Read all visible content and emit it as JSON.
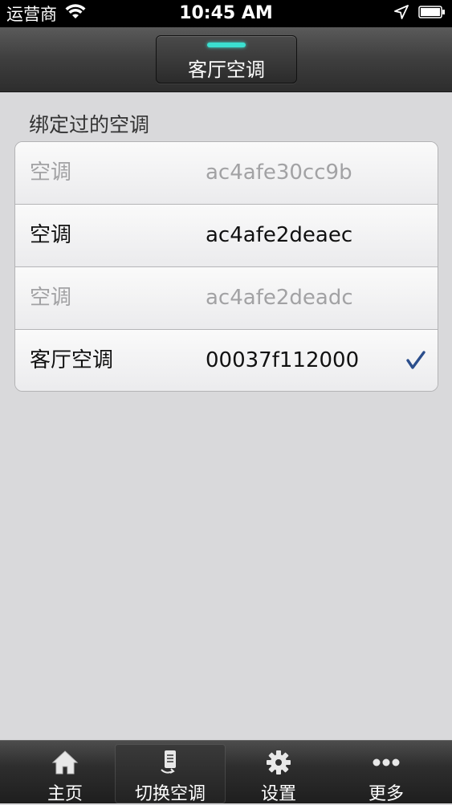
{
  "status_bar": {
    "carrier": "运营商",
    "time": "10:45 AM"
  },
  "nav": {
    "title": "客厅空调"
  },
  "section": {
    "header": "绑定过的空调"
  },
  "ac_list": [
    {
      "name": "空调",
      "mac": "ac4afe30cc9b",
      "state": "dim"
    },
    {
      "name": "空调",
      "mac": "ac4afe2deaec",
      "state": "active"
    },
    {
      "name": "空调",
      "mac": "ac4afe2deadc",
      "state": "dim"
    },
    {
      "name": "客厅空调",
      "mac": "00037f112000",
      "state": "active",
      "selected": true
    }
  ],
  "tab_bar": {
    "tabs": [
      {
        "label": "主页",
        "icon": "home-icon"
      },
      {
        "label": "切换空调",
        "icon": "switch-device-icon",
        "selected": true
      },
      {
        "label": "设置",
        "icon": "gear-icon"
      },
      {
        "label": "更多",
        "icon": "more-icon"
      }
    ]
  },
  "colors": {
    "accent_indicator": "#3be0d0",
    "check": "#2b4e8c"
  }
}
